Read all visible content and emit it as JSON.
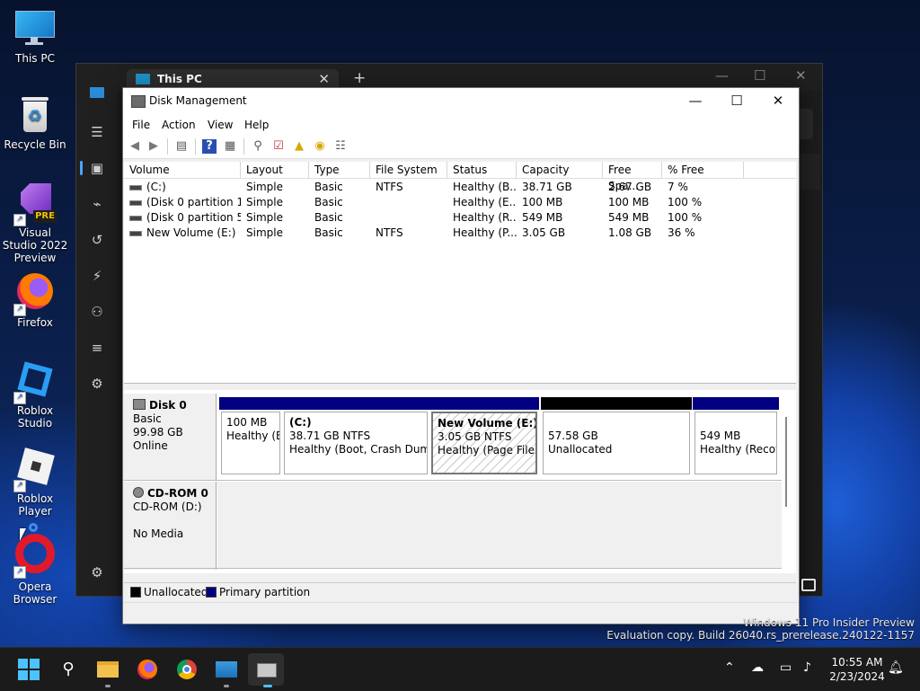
{
  "desktop": {
    "icons": [
      {
        "label": "This PC"
      },
      {
        "label": "Recycle Bin"
      },
      {
        "label": "Visual Studio 2022 Preview",
        "badge": "PRE"
      },
      {
        "label": "Firefox"
      },
      {
        "label": "Roblox Studio"
      },
      {
        "label": "Roblox Player"
      },
      {
        "label": "Opera Browser"
      }
    ],
    "watermark": {
      "line1": "Windows 11 Pro Insider Preview",
      "line2": "Evaluation copy. Build 26040.rs_prerelease.240122-1157"
    }
  },
  "explorer": {
    "tab_title": "This PC",
    "close_glyph": "✕",
    "new_tab_glyph": "+"
  },
  "disk_management": {
    "title": "Disk Management",
    "menu": [
      "File",
      "Action",
      "View",
      "Help"
    ],
    "columns": [
      "Volume",
      "Layout",
      "Type",
      "File System",
      "Status",
      "Capacity",
      "Free Spa...",
      "% Free"
    ],
    "volumes": [
      {
        "volume": "(C:)",
        "layout": "Simple",
        "type": "Basic",
        "fs": "NTFS",
        "status": "Healthy (B...",
        "capacity": "38.71 GB",
        "free": "2.67 GB",
        "pct": "7 %"
      },
      {
        "volume": "(Disk 0 partition 1)",
        "layout": "Simple",
        "type": "Basic",
        "fs": "",
        "status": "Healthy (E...",
        "capacity": "100 MB",
        "free": "100 MB",
        "pct": "100 %"
      },
      {
        "volume": "(Disk 0 partition 5)",
        "layout": "Simple",
        "type": "Basic",
        "fs": "",
        "status": "Healthy (R...",
        "capacity": "549 MB",
        "free": "549 MB",
        "pct": "100 %"
      },
      {
        "volume": "New Volume (E:)",
        "layout": "Simple",
        "type": "Basic",
        "fs": "NTFS",
        "status": "Healthy (P...",
        "capacity": "3.05 GB",
        "free": "1.08 GB",
        "pct": "36 %"
      }
    ],
    "disk0": {
      "name": "Disk 0",
      "type": "Basic",
      "size": "99.98 GB",
      "state": "Online",
      "partitions": [
        {
          "name": "",
          "size": "100 MB",
          "status": "Healthy (E"
        },
        {
          "name": "(C:)",
          "size": "38.71 GB NTFS",
          "status": "Healthy (Boot, Crash Dump,"
        },
        {
          "name": "New Volume  (E:)",
          "size": "3.05 GB NTFS",
          "status": "Healthy (Page File, B"
        },
        {
          "name": "",
          "size": "57.58 GB",
          "status": "Unallocated"
        },
        {
          "name": "",
          "size": "549 MB",
          "status": "Healthy (Recov"
        }
      ]
    },
    "cdrom0": {
      "name": "CD-ROM 0",
      "drive": "CD-ROM (D:)",
      "media": "No Media"
    },
    "legend": {
      "unallocated": "Unallocated",
      "primary": "Primary partition"
    },
    "colors": {
      "primary": "#000080",
      "unallocated": "#000000"
    }
  },
  "taskbar": {
    "time": "10:55 AM",
    "date": "2/23/2024"
  }
}
